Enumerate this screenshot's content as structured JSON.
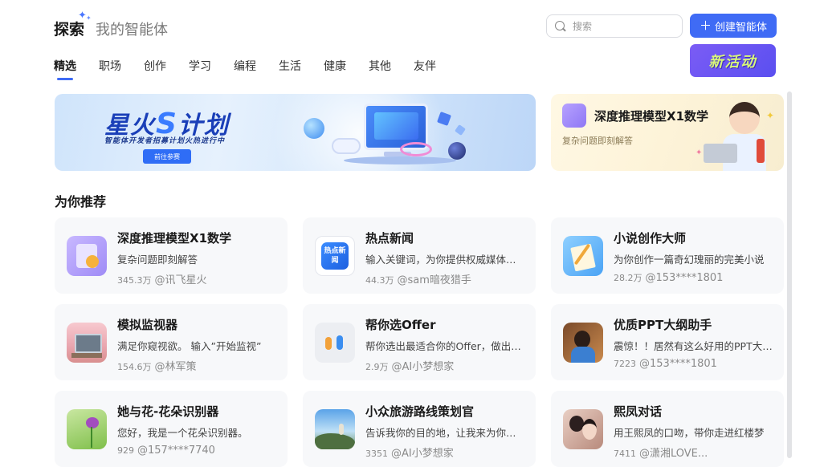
{
  "header": {
    "title": "探索",
    "subtitle": "我的智能体",
    "search_placeholder": "搜索",
    "create_label": "创建智能体",
    "event_label": "新活动"
  },
  "tabs": [
    {
      "label": "精选",
      "active": true
    },
    {
      "label": "职场"
    },
    {
      "label": "创作"
    },
    {
      "label": "学习"
    },
    {
      "label": "编程"
    },
    {
      "label": "生活"
    },
    {
      "label": "健康"
    },
    {
      "label": "其他"
    },
    {
      "label": "友伴"
    }
  ],
  "banners": {
    "main": {
      "title_pre": "星火",
      "title_s": "S",
      "title_post": "计划",
      "subtitle": "智能体开发者招募计划火热进行中",
      "button": "前往参赛"
    },
    "side": {
      "title": "深度推理模型X1数学",
      "subtitle": "复杂问题即刻解答"
    }
  },
  "section": {
    "title": "为你推荐"
  },
  "cards": [
    {
      "title": "深度推理模型X1数学",
      "desc": "复杂问题即刻解答",
      "count": "345.3万",
      "author": "@讯飞星火",
      "icon": "math-icon"
    },
    {
      "title": "热点新闻",
      "desc": "输入关键词，为你提供权威媒体报道",
      "count": "44.3万",
      "author": "@sam暗夜猎手",
      "icon": "news-icon",
      "icon_text": "热点新闻"
    },
    {
      "title": "小说创作大师",
      "desc": "为你创作一篇奇幻瑰丽的完美小说",
      "count": "28.2万",
      "author": "@153****1801",
      "icon": "novel-icon"
    },
    {
      "title": "模拟监视器",
      "desc": "满足你窥视欲。 输入”开始监视”",
      "count": "154.6万",
      "author": "@林军策",
      "icon": "monitor-icon"
    },
    {
      "title": "帮你选Offer",
      "desc": "帮你选出最适合你的Offer，做出选择",
      "count": "2.9万",
      "author": "@AI小梦想家",
      "icon": "offer-icon"
    },
    {
      "title": "优质PPT大纲助手",
      "desc": "震惊！！居然有这么好用的PPT大纲助手",
      "count": "7223",
      "author": "@153****1801",
      "icon": "ppt-icon"
    },
    {
      "title": "她与花-花朵识别器",
      "desc": "您好，我是一个花朵识别器。",
      "count": "929",
      "author": "@157****7740",
      "icon": "flower-icon"
    },
    {
      "title": "小众旅游路线策划官",
      "desc": "告诉我你的目的地，让我来为你策划",
      "count": "3351",
      "author": "@AI小梦想家",
      "icon": "travel-icon"
    },
    {
      "title": "熙凤对话",
      "desc": "用王熙凤的口吻，带你走进红楼梦",
      "count": "7411",
      "author": "@潇湘LOVE...",
      "icon": "xifeng-icon"
    }
  ]
}
